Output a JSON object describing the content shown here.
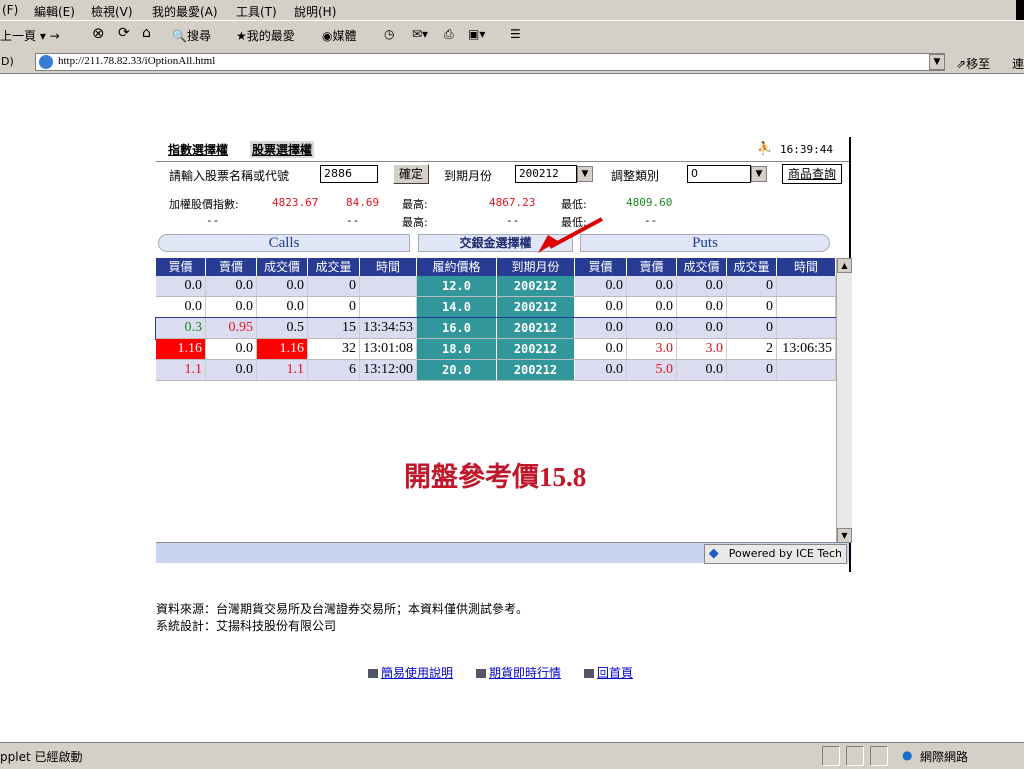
{
  "browser": {
    "menu": [
      "(F)",
      "編輯(E)",
      "檢視(V)",
      "我的最愛(A)",
      "工具(T)",
      "說明(H)"
    ],
    "toolbar": {
      "back": "上一頁",
      "search": "搜尋",
      "favorites": "我的最愛",
      "media": "媒體"
    },
    "address_label": "D)",
    "url": "http://211.78.82.33/iOptionAll.html",
    "go_label": "移至",
    "links_label": "連",
    "status_text": "pplet 已經啟動",
    "zone_text": "網際網路"
  },
  "applet": {
    "tabs": [
      "指數選擇權",
      "股票選擇權"
    ],
    "clock": "16:39:44",
    "stock_prompt": "請輸入股票名稱或代號",
    "stock_value": "2886",
    "confirm_label": "確定",
    "month_label": "到期月份",
    "month_value": "200212",
    "adjust_label": "調整類別",
    "adjust_value": "0",
    "query_label": "商品查詢",
    "index_label": "加權股價指數:",
    "index_value": "4823.67",
    "index_change": "84.69",
    "high_label": "最高:",
    "high_value": "4867.23",
    "low_label": "最低:",
    "low_value": "4809.60",
    "row2_left": "--",
    "row2_change": "--",
    "row2_high_label": "最高:",
    "row2_high": "--",
    "row2_low_label": "最低:",
    "row2_low": "--",
    "calls_title": "Calls",
    "center_title": "交銀金選擇權",
    "puts_title": "Puts",
    "columns": [
      "買價",
      "賣價",
      "成交價",
      "成交量",
      "時間",
      "履約價格",
      "到期月份",
      "買價",
      "賣價",
      "成交價",
      "成交量",
      "時間"
    ],
    "rows": [
      {
        "c_bid": "0.0",
        "c_ask": "0.0",
        "c_last": "0.0",
        "c_vol": "0",
        "c_time": "",
        "strike": "12.0",
        "month": "200212",
        "p_bid": "0.0",
        "p_ask": "0.0",
        "p_last": "0.0",
        "p_vol": "0",
        "p_time": ""
      },
      {
        "c_bid": "0.0",
        "c_ask": "0.0",
        "c_last": "0.0",
        "c_vol": "0",
        "c_time": "",
        "strike": "14.0",
        "month": "200212",
        "p_bid": "0.0",
        "p_ask": "0.0",
        "p_last": "0.0",
        "p_vol": "0",
        "p_time": ""
      },
      {
        "c_bid": "0.3",
        "c_ask": "0.95",
        "c_last": "0.5",
        "c_vol": "15",
        "c_time": "13:34:53",
        "strike": "16.0",
        "month": "200212",
        "p_bid": "0.0",
        "p_ask": "0.0",
        "p_last": "0.0",
        "p_vol": "0",
        "p_time": ""
      },
      {
        "c_bid": "1.16",
        "c_ask": "0.0",
        "c_last": "1.16",
        "c_vol": "32",
        "c_time": "13:01:08",
        "strike": "18.0",
        "month": "200212",
        "p_bid": "0.0",
        "p_ask": "3.0",
        "p_last": "3.0",
        "p_vol": "2",
        "p_time": "13:06:35"
      },
      {
        "c_bid": "1.1",
        "c_ask": "0.0",
        "c_last": "1.1",
        "c_vol": "6",
        "c_time": "13:12:00",
        "strike": "20.0",
        "month": "200212",
        "p_bid": "0.0",
        "p_ask": "5.0",
        "p_last": "0.0",
        "p_vol": "0",
        "p_time": ""
      }
    ],
    "overlay_text": "開盤參考價15.8",
    "powered_by": "Powered by ICE Tech",
    "colors": {
      "header_bg": "#283c94",
      "center_bg": "#31979a",
      "shade_row": "#dcdcf0",
      "red": "#e8111f",
      "green": "#1a8c1a",
      "highlight_red": "#ff0000"
    }
  },
  "notes": {
    "source": "資料來源：台灣期貨交易所及台灣證券交易所；本資料僅供測試參考。",
    "design": "系統設計：艾揚科技股份有限公司"
  },
  "links": [
    "簡易使用說明",
    "期貨即時行情",
    "回首頁"
  ]
}
